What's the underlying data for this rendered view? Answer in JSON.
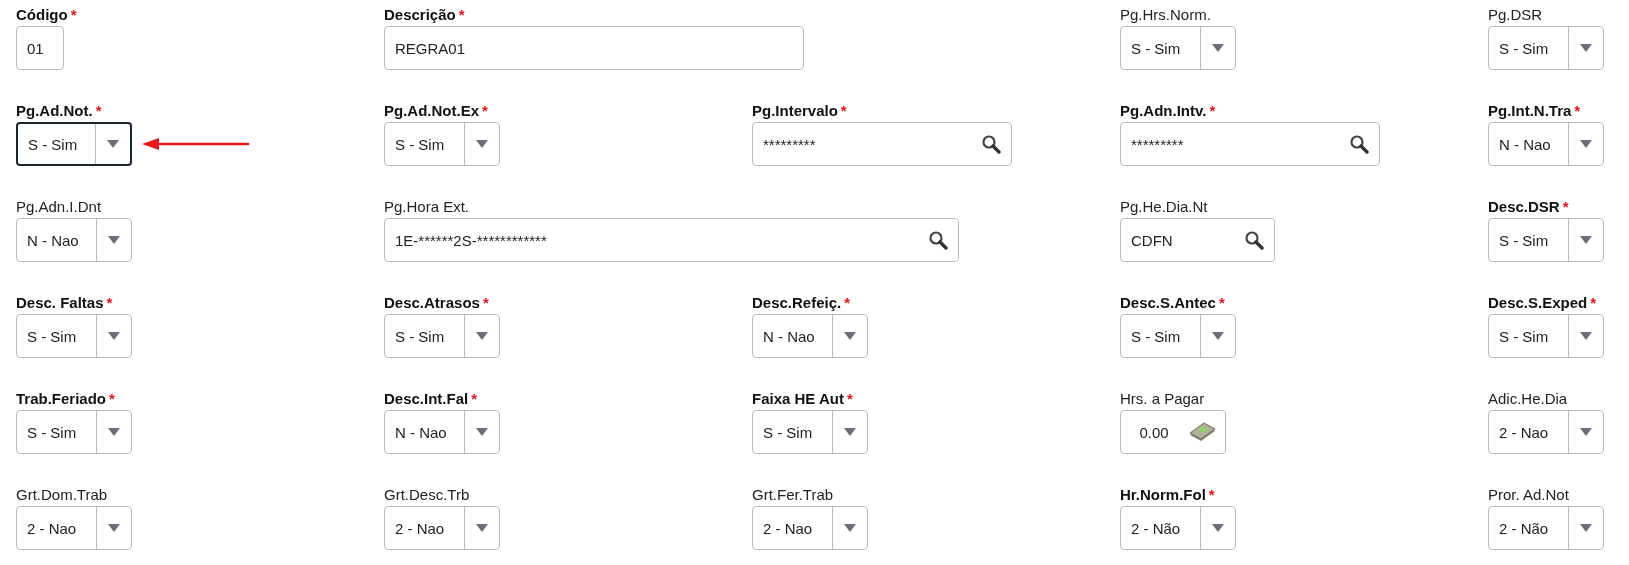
{
  "fields": [
    {
      "label": "Código",
      "marker": "*",
      "kind": "code_text",
      "value": "01"
    },
    {
      "label": "Descrição",
      "marker": "*",
      "kind": "long_text",
      "value": "REGRA01"
    },
    {
      "label": "Pg.Hrs.Norm.",
      "kind": "select",
      "value": "S - Sim"
    },
    {
      "label": "Pg.DSR",
      "kind": "select",
      "value": "S - Sim"
    },
    {
      "label": "Pg.Ad.Not.",
      "marker": "*",
      "kind": "select",
      "value": "S - Sim",
      "focused": true,
      "pointer": true
    },
    {
      "label": "Pg.Ad.Not.Ex",
      "marker": "*",
      "kind": "select",
      "value": "S - Sim"
    },
    {
      "label": "Pg.Intervalo",
      "marker": "*",
      "kind": "lookup",
      "value": "*********"
    },
    {
      "label": "Pg.Adn.Intv.",
      "marker": "*",
      "kind": "lookup",
      "value": "*********"
    },
    {
      "label": "Pg.Int.N.Tra",
      "marker": "*",
      "kind": "select",
      "value": "N - Nao"
    },
    {
      "label": "Pg.Adn.I.Dnt",
      "kind": "select",
      "value": "N - Nao"
    },
    {
      "label": "Pg.Hora Ext.",
      "kind": "wide_lookup",
      "value": "1E-******2S-************"
    },
    {
      "label": "Pg.He.Dia.Nt",
      "kind": "short_lookup",
      "value": "CDFN"
    },
    {
      "label": "Desc.DSR",
      "marker": "*",
      "kind": "select",
      "value": "S - Sim"
    },
    {
      "label": "Desc. Faltas",
      "marker": "*",
      "kind": "select",
      "value": "S - Sim"
    },
    {
      "label": "Desc.Atrasos",
      "marker": "*",
      "kind": "select",
      "value": "S - Sim"
    },
    {
      "label": "Desc.Refeiç.",
      "marker": "*",
      "kind": "select",
      "value": "N - Nao"
    },
    {
      "label": "Desc.S.Antec",
      "marker": "*",
      "kind": "select",
      "value": "S - Sim"
    },
    {
      "label": "Desc.S.Exped",
      "marker": "*",
      "kind": "select",
      "value": "S - Sim"
    },
    {
      "label": "Trab.Feriado",
      "marker": "*",
      "kind": "select",
      "value": "S - Sim"
    },
    {
      "label": "Desc.Int.Fal",
      "marker": "*",
      "kind": "select",
      "value": "N - Nao"
    },
    {
      "label": "Faixa HE Aut",
      "marker": "*",
      "kind": "select",
      "value": "S - Sim"
    },
    {
      "label": "Hrs. a Pagar",
      "kind": "number",
      "value": "0.00"
    },
    {
      "label": "Adic.He.Dia",
      "kind": "select",
      "value": "2 - Nao"
    },
    {
      "label": "Grt.Dom.Trab",
      "kind": "select",
      "value": "2 - Nao"
    },
    {
      "label": "Grt.Desc.Trb",
      "kind": "select",
      "value": "2 - Nao"
    },
    {
      "label": "Grt.Fer.Trab",
      "kind": "select",
      "value": "2 - Nao"
    },
    {
      "label": "Hr.Norm.Fol",
      "marker": "*",
      "kind": "select",
      "value": "2 - Não"
    },
    {
      "label": "Pror. Ad.Not",
      "kind": "select",
      "value": "2 - Não"
    }
  ]
}
